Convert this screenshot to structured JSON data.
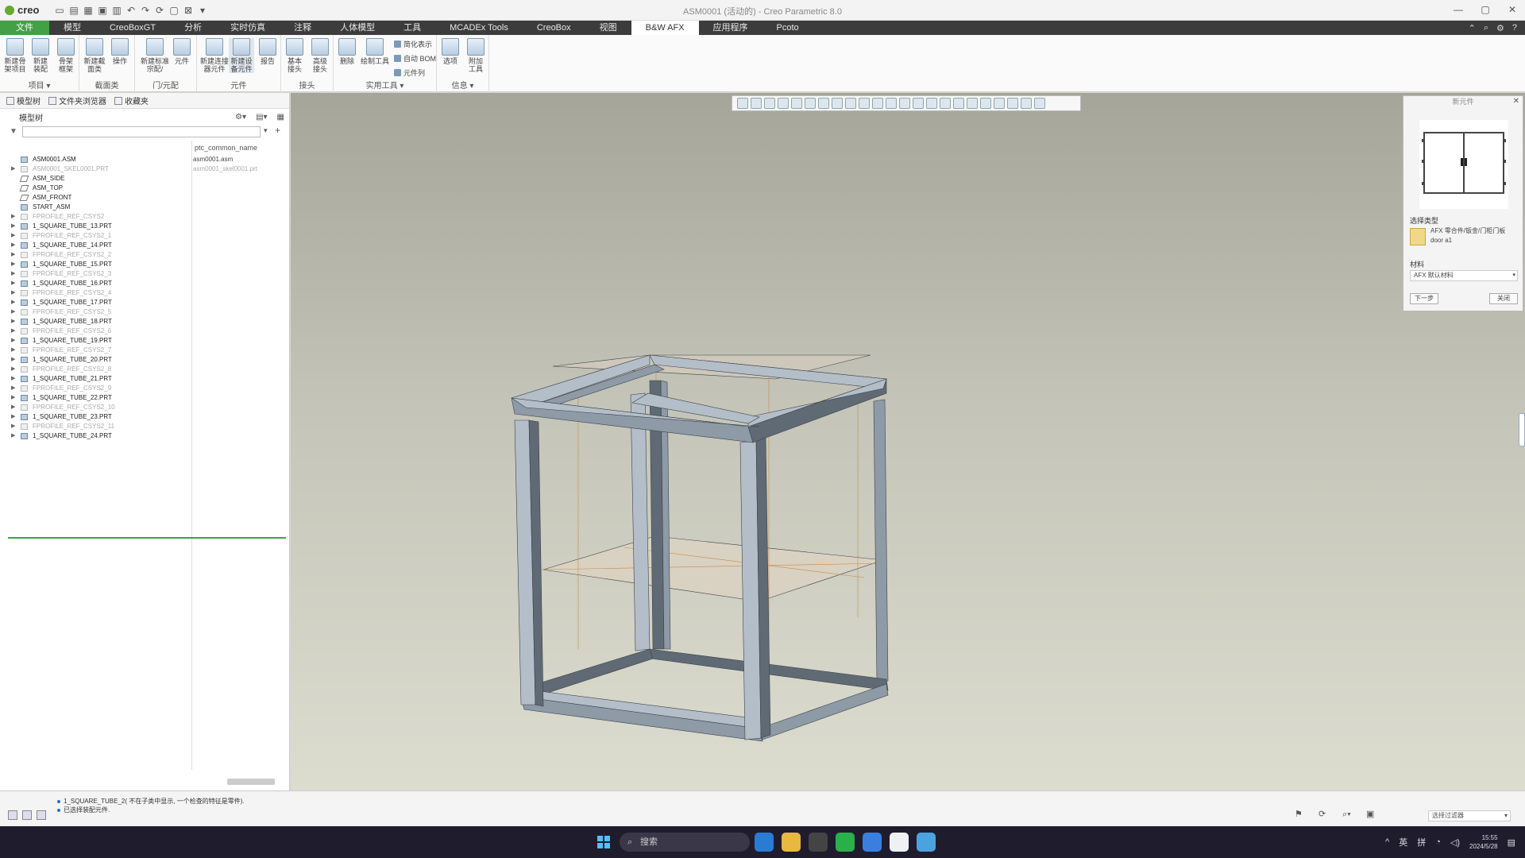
{
  "window": {
    "logo": "creo",
    "title": "ASM0001 (活动的) - Creo Parametric 8.0",
    "controls": [
      "—",
      "▢",
      "✕"
    ]
  },
  "tabs": [
    "文件",
    "模型",
    "CreoBoxGT",
    "分析",
    "实时仿真",
    "注释",
    "人体模型",
    "工具",
    "MCADEx Tools",
    "CreoBox",
    "视图",
    "B&W AFX",
    "应用程序",
    "Pcoto"
  ],
  "active_tab": "B&W AFX",
  "ribbon": {
    "groups": [
      {
        "label": "项目 ▾",
        "buttons": [
          "新建骨\n架项目",
          "新建\n装配",
          "骨架\n框架"
        ]
      },
      {
        "label": "截面类",
        "buttons": [
          "新建截\n面类",
          "操作"
        ]
      },
      {
        "label": "门/元配",
        "buttons": [
          "新建标准\n宗配/",
          "元件"
        ]
      },
      {
        "label": "元件",
        "buttons": [
          "新建连接\n器元件",
          "新建设\n备元件",
          "报告"
        ]
      },
      {
        "label": "接头",
        "buttons": [
          "基本\n接头",
          "高级\n接头"
        ]
      },
      {
        "label": "实用工具 ▾",
        "buttons": [
          "删除",
          "绘制工具"
        ]
      },
      {
        "label": "信息 ▾",
        "buttons": [
          "选项",
          "附加\n工具"
        ]
      }
    ],
    "small_items": [
      "简化表示",
      "自动 BOM",
      "元件列"
    ]
  },
  "left_panel": {
    "nav_tabs": [
      "模型树",
      "文件夹浏览器",
      "收藏夹"
    ],
    "tree_title": "模型树",
    "column_header": "ptc_common_name",
    "tree": [
      {
        "name": "ASM0001.ASM",
        "value": "asm0001.asm",
        "icon": "assembly",
        "dim": false,
        "expand": false
      },
      {
        "name": "ASM0001_SKEL0001.PRT",
        "value": "asm0001_skel0001.prt",
        "icon": "part",
        "dim": true,
        "expand": true
      },
      {
        "name": "ASM_SIDE",
        "value": "",
        "icon": "plane",
        "dim": false,
        "expand": false
      },
      {
        "name": "ASM_TOP",
        "value": "",
        "icon": "plane",
        "dim": false,
        "expand": false
      },
      {
        "name": "ASM_FRONT",
        "value": "",
        "icon": "plane",
        "dim": false,
        "expand": false
      },
      {
        "name": "START_ASM",
        "value": "",
        "icon": "csys",
        "dim": false,
        "expand": false
      },
      {
        "name": "FPROFILE_REF_CSYS2",
        "value": "",
        "icon": "part",
        "dim": true,
        "expand": true
      },
      {
        "name": "1_SQUARE_TUBE_13.PRT",
        "value": "",
        "icon": "part",
        "dim": false,
        "expand": true
      },
      {
        "name": "FPROFILE_REF_CSYS2_1",
        "value": "",
        "icon": "part",
        "dim": true,
        "expand": true
      },
      {
        "name": "1_SQUARE_TUBE_14.PRT",
        "value": "",
        "icon": "part",
        "dim": false,
        "expand": true
      },
      {
        "name": "FPROFILE_REF_CSYS2_2",
        "value": "",
        "icon": "part",
        "dim": true,
        "expand": true
      },
      {
        "name": "1_SQUARE_TUBE_15.PRT",
        "value": "",
        "icon": "part",
        "dim": false,
        "expand": true
      },
      {
        "name": "FPROFILE_REF_CSYS2_3",
        "value": "",
        "icon": "part",
        "dim": true,
        "expand": true
      },
      {
        "name": "1_SQUARE_TUBE_16.PRT",
        "value": "",
        "icon": "part",
        "dim": false,
        "expand": true
      },
      {
        "name": "FPROFILE_REF_CSYS2_4",
        "value": "",
        "icon": "part",
        "dim": true,
        "expand": true
      },
      {
        "name": "1_SQUARE_TUBE_17.PRT",
        "value": "",
        "icon": "part",
        "dim": false,
        "expand": true
      },
      {
        "name": "FPROFILE_REF_CSYS2_5",
        "value": "",
        "icon": "part",
        "dim": true,
        "expand": true
      },
      {
        "name": "1_SQUARE_TUBE_18.PRT",
        "value": "",
        "icon": "part",
        "dim": false,
        "expand": true
      },
      {
        "name": "FPROFILE_REF_CSYS2_6",
        "value": "",
        "icon": "part",
        "dim": true,
        "expand": true
      },
      {
        "name": "1_SQUARE_TUBE_19.PRT",
        "value": "",
        "icon": "part",
        "dim": false,
        "expand": true
      },
      {
        "name": "FPROFILE_REF_CSYS2_7",
        "value": "",
        "icon": "part",
        "dim": true,
        "expand": true
      },
      {
        "name": "1_SQUARE_TUBE_20.PRT",
        "value": "",
        "icon": "part",
        "dim": false,
        "expand": true
      },
      {
        "name": "FPROFILE_REF_CSYS2_8",
        "value": "",
        "icon": "part",
        "dim": true,
        "expand": true
      },
      {
        "name": "1_SQUARE_TUBE_21.PRT",
        "value": "",
        "icon": "part",
        "dim": false,
        "expand": true
      },
      {
        "name": "FPROFILE_REF_CSYS2_9",
        "value": "",
        "icon": "part",
        "dim": true,
        "expand": true
      },
      {
        "name": "1_SQUARE_TUBE_22.PRT",
        "value": "",
        "icon": "part",
        "dim": false,
        "expand": true
      },
      {
        "name": "FPROFILE_REF_CSYS2_10",
        "value": "",
        "icon": "part",
        "dim": true,
        "expand": true
      },
      {
        "name": "1_SQUARE_TUBE_23.PRT",
        "value": "",
        "icon": "part",
        "dim": false,
        "expand": true
      },
      {
        "name": "FPROFILE_REF_CSYS2_11",
        "value": "",
        "icon": "part",
        "dim": true,
        "expand": true
      },
      {
        "name": "1_SQUARE_TUBE_24.PRT",
        "value": "",
        "icon": "part",
        "dim": false,
        "expand": true
      }
    ]
  },
  "dialog": {
    "title": "新元件",
    "type_label": "选择类型",
    "type_text": "AFX 零合件/钣金/门柜门板",
    "type_sub": "door a1",
    "material_label": "材料",
    "material_value": "AFX 默认材料",
    "next_button": "下一步",
    "close_button": "关闭"
  },
  "status": {
    "messages": [
      "1_SQUARE_TUBE_2( 不在子类中显示, 一个检查的特征是零件).",
      "已选择装配元件."
    ],
    "filter": "选择过滤器"
  },
  "taskbar": {
    "search_placeholder": "搜索",
    "tray": [
      "^",
      "英",
      "拼",
      "◔",
      "◁)"
    ],
    "time": "15:55",
    "date": "2024/5/28"
  },
  "colors": {
    "file_tab": "#43a047",
    "active_tab_bg": "#ffffff",
    "tube": "#8e9aa6",
    "tube_dark": "#5f6a74",
    "tube_light": "#b4bec8",
    "accent_line": "#43a047"
  },
  "icons": {
    "toolbar": [
      "new-icon",
      "open-icon",
      "save-icon",
      "undo-icon",
      "redo-icon",
      "regenerate-icon",
      "close-window-icon"
    ],
    "view_toolbar": [
      "refit-icon",
      "zoom-in-icon",
      "zoom-out-icon",
      "repaint-icon",
      "orientation-icon",
      "view-manager-icon",
      "display-style-icon",
      "datum-display-icon",
      "annotation-display-icon",
      "spin-center-icon",
      "perspective-icon",
      "pause-icon",
      "section-icon"
    ]
  }
}
